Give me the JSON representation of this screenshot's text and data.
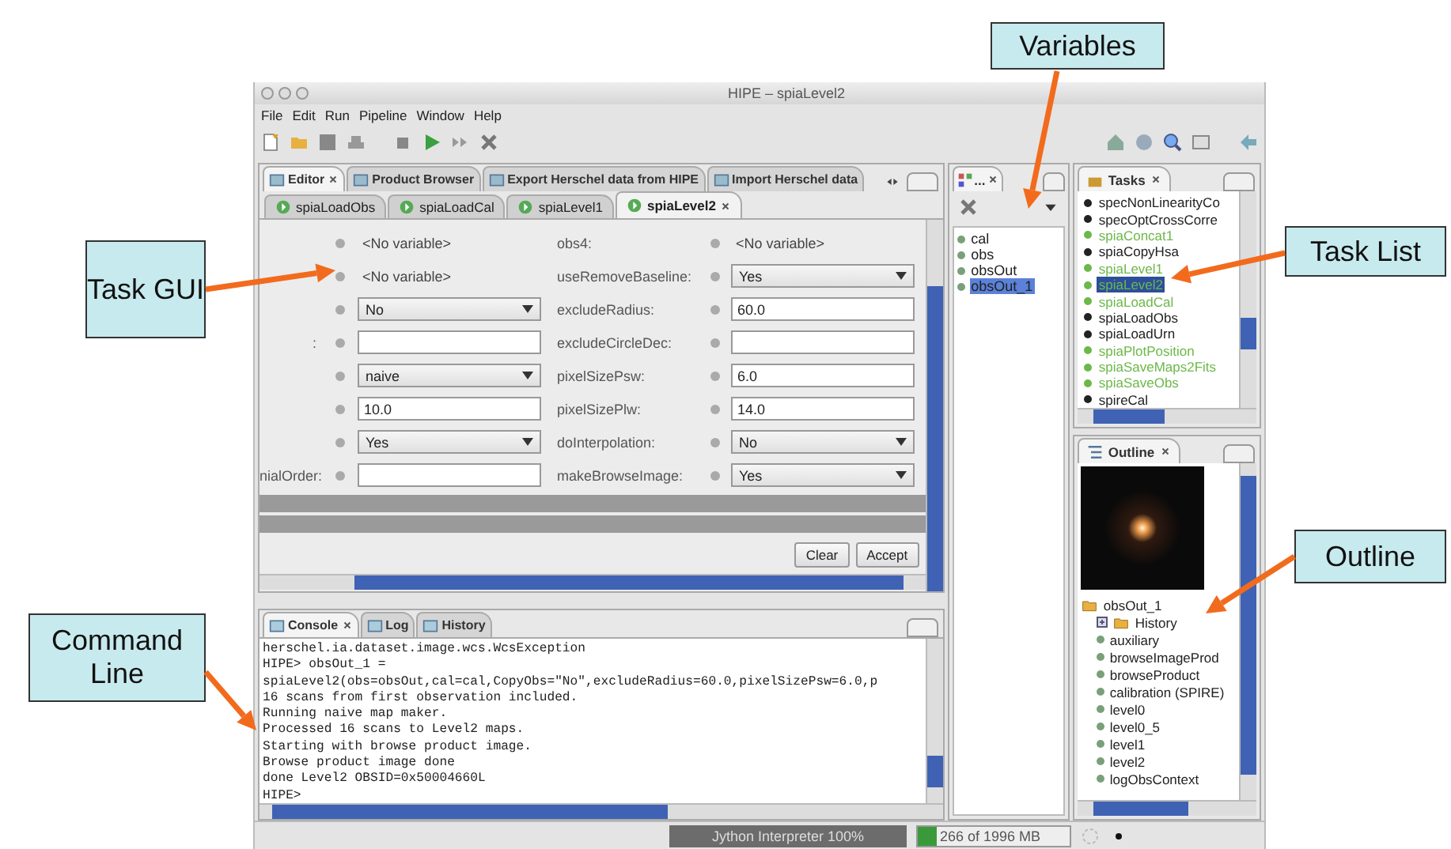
{
  "window": {
    "title": "HIPE – spiaLevel2"
  },
  "menu": [
    "File",
    "Edit",
    "Run",
    "Pipeline",
    "Window",
    "Help"
  ],
  "editor": {
    "tabs": [
      {
        "label": "Editor",
        "selected": true
      },
      {
        "label": "Product Browser",
        "selected": false
      },
      {
        "label": "Export Herschel data from HIPE",
        "selected": false
      },
      {
        "label": "Import Herschel data",
        "selected": false
      }
    ],
    "subtabs": [
      {
        "label": "spiaLoadObs",
        "selected": false
      },
      {
        "label": "spiaLoadCal",
        "selected": false
      },
      {
        "label": "spiaLevel1",
        "selected": false
      },
      {
        "label": "spiaLevel2",
        "selected": true
      }
    ],
    "form": {
      "rows": [
        {
          "right_label": "obs4:",
          "left": {
            "kind": "variable",
            "value": "<No variable>"
          },
          "right": {
            "kind": "variable",
            "value": "<No variable>"
          }
        },
        {
          "right_label": "useRemoveBaseline:",
          "left": {
            "kind": "variable",
            "value": "<No variable>"
          },
          "right": {
            "kind": "select",
            "value": "Yes"
          }
        },
        {
          "right_label": "excludeRadius:",
          "left": {
            "kind": "select",
            "value": "No"
          },
          "right": {
            "kind": "input",
            "value": "60.0"
          }
        },
        {
          "left_label": ":",
          "right_label": "excludeCircleDec:",
          "left": {
            "kind": "input"
          },
          "right": {
            "kind": "input"
          }
        },
        {
          "right_label": "pixelSizePsw:",
          "left": {
            "kind": "select",
            "value": "naive"
          },
          "right": {
            "kind": "input",
            "value": "6.0"
          }
        },
        {
          "right_label": "pixelSizePlw:",
          "left": {
            "kind": "input",
            "value": "10.0"
          },
          "right": {
            "kind": "input",
            "value": "14.0"
          }
        },
        {
          "right_label": "doInterpolation:",
          "left": {
            "kind": "select",
            "value": "Yes"
          },
          "right": {
            "kind": "select",
            "value": "No"
          }
        },
        {
          "left_label": "nialOrder:",
          "right_label": "makeBrowseImage:",
          "left": {
            "kind": "input"
          },
          "right": {
            "kind": "select",
            "value": "Yes"
          }
        }
      ],
      "buttons": [
        "Clear",
        "Accept"
      ]
    }
  },
  "console": {
    "tabs": [
      {
        "label": "Console",
        "selected": true
      },
      {
        "label": "Log",
        "selected": false
      },
      {
        "label": "History",
        "selected": false
      }
    ],
    "lines": [
      "herschel.ia.dataset.image.wcs.WcsException",
      "HIPE> obsOut_1 =",
      "spiaLevel2(obs=obsOut,cal=cal,CopyObs=\"No\",excludeRadius=60.0,pixelSizePsw=6.0,p",
      "16 scans from first observation included.",
      "Running naive map maker.",
      "Processed 16 scans to Level2 maps.",
      "Starting with browse product image.",
      "Browse product image done",
      "done Level2 OBSID=0x50004660L",
      "HIPE>"
    ]
  },
  "variables": {
    "tab_label": "...",
    "items": [
      {
        "name": "cal",
        "selected": false
      },
      {
        "name": "obs",
        "selected": false
      },
      {
        "name": "obsOut",
        "selected": false
      },
      {
        "name": "obsOut_1",
        "selected": true
      }
    ]
  },
  "tasks": {
    "title": "Tasks",
    "items": [
      {
        "name": "specNonLinearityCo",
        "color": "#222222",
        "selected": false
      },
      {
        "name": "specOptCrossCorre",
        "color": "#222222",
        "selected": false
      },
      {
        "name": "spiaConcat1",
        "color": "#6cb84a",
        "selected": false
      },
      {
        "name": "spiaCopyHsa",
        "color": "#222222",
        "selected": false
      },
      {
        "name": "spiaLevel1",
        "color": "#6cb84a",
        "selected": false
      },
      {
        "name": "spiaLevel2",
        "color": "#6cb84a",
        "selected": true
      },
      {
        "name": "spiaLoadCal",
        "color": "#6cb84a",
        "selected": false
      },
      {
        "name": "spiaLoadObs",
        "color": "#222222",
        "selected": false
      },
      {
        "name": "spiaLoadUrn",
        "color": "#222222",
        "selected": false
      },
      {
        "name": "spiaPlotPosition",
        "color": "#6cb84a",
        "selected": false
      },
      {
        "name": "spiaSaveMaps2Fits",
        "color": "#6cb84a",
        "selected": false
      },
      {
        "name": "spiaSaveObs",
        "color": "#6cb84a",
        "selected": false
      },
      {
        "name": "spireCal",
        "color": "#222222",
        "selected": false
      }
    ]
  },
  "outline": {
    "title": "Outline",
    "tree": [
      {
        "label": "obsOut_1",
        "expanded": true,
        "children": [
          {
            "label": "History",
            "expanded": false
          },
          {
            "label": "auxiliary"
          },
          {
            "label": "browseImageProd"
          },
          {
            "label": "browseProduct"
          },
          {
            "label": "calibration (SPIRE)"
          },
          {
            "label": "level0"
          },
          {
            "label": "level0_5"
          },
          {
            "label": "level1"
          },
          {
            "label": "level2"
          },
          {
            "label": "logObsContext"
          }
        ]
      }
    ]
  },
  "status_bar": {
    "interpreter": "Jython Interpreter 100%",
    "memory": {
      "text": "266 of 1996 MB",
      "level": 0.13
    }
  },
  "callouts": [
    "Variables",
    "Task GUI",
    "Task List",
    "Outline",
    "Command Line"
  ]
}
